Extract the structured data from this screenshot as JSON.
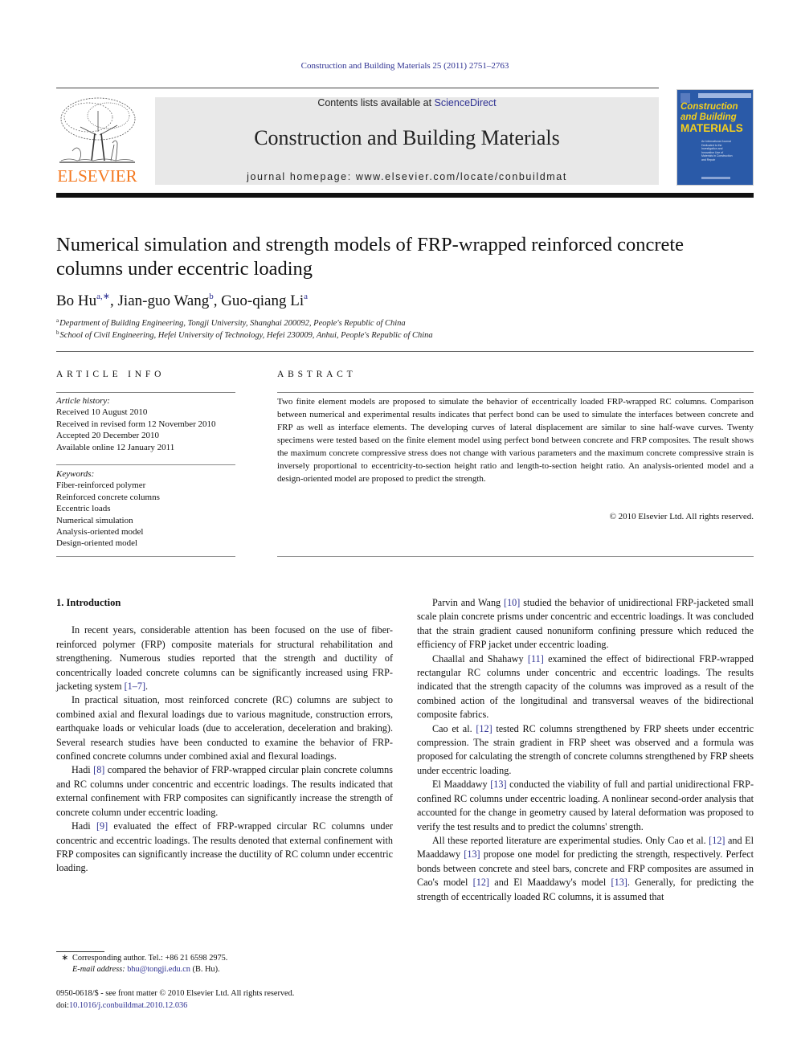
{
  "journal_ref": "Construction and Building Materials 25 (2011) 2751–2763",
  "masthead": {
    "publisher_logo_text": "ELSEVIER",
    "contents_prefix": "Contents lists available at ",
    "contents_link": "ScienceDirect",
    "journal_title": "Construction and Building Materials",
    "homepage": "journal homepage: www.elsevier.com/locate/conbuildmat"
  },
  "cover": {
    "line1": "Construction",
    "line2": "and Building",
    "line3": "MATERIALS",
    "subtitle": "An International Journal Dedicated to the Investigation and Innovative Use of Materials in Construction and Repair"
  },
  "article": {
    "title": "Numerical simulation and strength models of FRP-wrapped reinforced concrete columns under eccentric loading",
    "authors": [
      {
        "name": "Bo Hu",
        "sup": "a,∗"
      },
      {
        "name": "Jian-guo Wang",
        "sup": "b"
      },
      {
        "name": "Guo-qiang Li",
        "sup": "a"
      }
    ],
    "affiliations": [
      {
        "sup": "a",
        "text": "Department of Building Engineering, Tongji University, Shanghai 200092, People's Republic of China"
      },
      {
        "sup": "b",
        "text": "School of Civil Engineering, Hefei University of Technology, Hefei 230009, Anhui, People's Republic of China"
      }
    ]
  },
  "article_info": {
    "heading": "ARTICLE INFO",
    "history_label": "Article history:",
    "history": [
      "Received 10 August 2010",
      "Received in revised form 12 November 2010",
      "Accepted 20 December 2010",
      "Available online 12 January 2011"
    ],
    "keywords_label": "Keywords:",
    "keywords": [
      "Fiber-reinforced polymer",
      "Reinforced concrete columns",
      "Eccentric loads",
      "Numerical simulation",
      "Analysis-oriented model",
      "Design-oriented model"
    ]
  },
  "abstract": {
    "heading": "ABSTRACT",
    "text": "Two finite element models are proposed to simulate the behavior of eccentrically loaded FRP-wrapped RC columns. Comparison between numerical and experimental results indicates that perfect bond can be used to simulate the interfaces between concrete and FRP as well as interface elements. The developing curves of lateral displacement are similar to sine half-wave curves. Twenty specimens were tested based on the finite element model using perfect bond between concrete and FRP composites. The result shows the maximum concrete compressive stress does not change with various parameters and the maximum concrete compressive strain is inversely proportional to eccentricity-to-section height ratio and length-to-section height ratio. An analysis-oriented model and a design-oriented model are proposed to predict the strength.",
    "copyright": "© 2010 Elsevier Ltd. All rights reserved."
  },
  "body": {
    "section_title": "1. Introduction",
    "left_paragraphs": [
      [
        {
          "t": "In recent years, considerable attention has been focused on the use of fiber-reinforced polymer (FRP) composite materials for structural rehabilitation and strengthening. Numerous studies reported that the strength and ductility of concentrically loaded concrete columns can be significantly increased using FRP-jacketing system "
        },
        {
          "c": "[1–7]"
        },
        {
          "t": "."
        }
      ],
      [
        {
          "t": "In practical situation, most reinforced concrete (RC) columns are subject to combined axial and flexural loadings due to various magnitude, construction errors, earthquake loads or vehicular loads (due to acceleration, deceleration and braking). Several research studies have been conducted to examine the behavior of FRP-confined concrete columns under combined axial and flexural loadings."
        }
      ],
      [
        {
          "t": "Hadi "
        },
        {
          "c": "[8]"
        },
        {
          "t": " compared the behavior of FRP-wrapped circular plain concrete columns and RC columns under concentric and eccentric loadings. The results indicated that external confinement with FRP composites can significantly increase the strength of concrete column under eccentric loading."
        }
      ],
      [
        {
          "t": "Hadi "
        },
        {
          "c": "[9]"
        },
        {
          "t": " evaluated the effect of FRP-wrapped circular RC columns under concentric and eccentric loadings. The results denoted that external confinement with FRP composites can significantly increase the ductility of RC column under eccentric loading."
        }
      ]
    ],
    "right_paragraphs": [
      [
        {
          "t": "Parvin and Wang "
        },
        {
          "c": "[10]"
        },
        {
          "t": " studied the behavior of unidirectional FRP-jacketed small scale plain concrete prisms under concentric and eccentric loadings. It was concluded that the strain gradient caused nonuniform confining pressure which reduced the efficiency of FRP jacket under eccentric loading."
        }
      ],
      [
        {
          "t": "Chaallal and Shahawy "
        },
        {
          "c": "[11]"
        },
        {
          "t": " examined the effect of bidirectional FRP-wrapped rectangular RC columns under concentric and eccentric loadings. The results indicated that the strength capacity of the columns was improved as a result of the combined action of the longitudinal and transversal weaves of the bidirectional composite fabrics."
        }
      ],
      [
        {
          "t": "Cao et al. "
        },
        {
          "c": "[12]"
        },
        {
          "t": " tested RC columns strengthened by FRP sheets under eccentric compression. The strain gradient in FRP sheet was observed and a formula was proposed for calculating the strength of concrete columns strengthened by FRP sheets under eccentric loading."
        }
      ],
      [
        {
          "t": "El Maaddawy "
        },
        {
          "c": "[13]"
        },
        {
          "t": " conducted the viability of full and partial unidirectional FRP-confined RC columns under eccentric loading. A nonlinear second-order analysis that accounted for the change in geometry caused by lateral deformation was proposed to verify the test results and to predict the columns' strength."
        }
      ],
      [
        {
          "t": "All these reported literature are experimental studies. Only Cao et al. "
        },
        {
          "c": "[12]"
        },
        {
          "t": " and El Maaddawy "
        },
        {
          "c": "[13]"
        },
        {
          "t": " propose one model for predicting the strength, respectively. Perfect bonds between concrete and steel bars, concrete and FRP composites are assumed in Cao's model "
        },
        {
          "c": "[12]"
        },
        {
          "t": " and El Maaddawy's model "
        },
        {
          "c": "[13]"
        },
        {
          "t": ". Generally, for predicting the strength of eccentrically loaded RC columns, it is assumed that"
        }
      ]
    ]
  },
  "footnotes": {
    "star": "∗",
    "corresponding": "Corresponding author. Tel.: +86 21 6598 2975.",
    "email_label": "E-mail address:",
    "email": "bhu@tongji.edu.cn",
    "email_suffix": " (B. Hu).",
    "issn": "0950-0618/$ - see front matter © 2010 Elsevier Ltd. All rights reserved.",
    "doi_label": "doi:",
    "doi": "10.1016/j.conbuildmat.2010.12.036"
  },
  "colors": {
    "link": "#2e3192",
    "elsevier_orange": "#f47920",
    "masthead_bg": "#e8e8e8",
    "cover_blue": "#2a5aa8",
    "cover_yellow": "#f6d01c"
  }
}
